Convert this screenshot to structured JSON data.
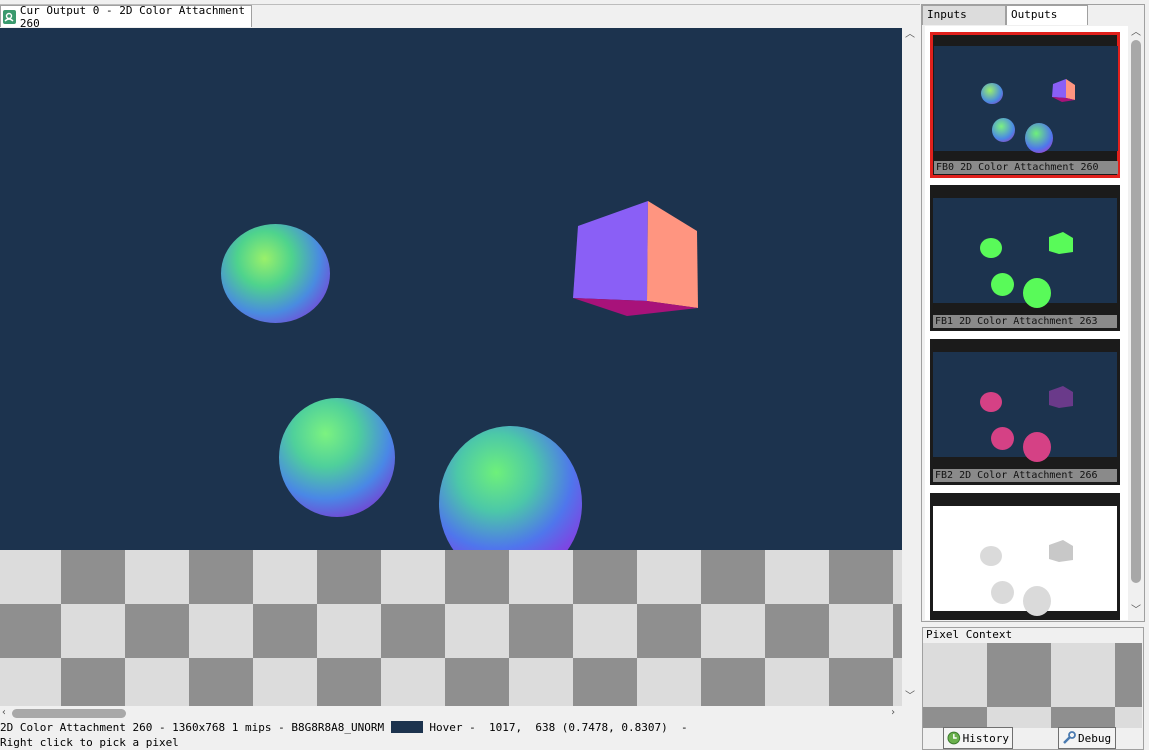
{
  "main_tab": {
    "title": "Cur Output 0 - 2D Color Attachment 260"
  },
  "right_panel": {
    "tabs": {
      "inputs": "Inputs",
      "outputs": "Outputs"
    },
    "thumbnails": [
      {
        "label": "FB0   2D Color Attachment 260",
        "selected": true
      },
      {
        "label": "FB1   2D Color Attachment 263",
        "selected": false
      },
      {
        "label": "FB2   2D Color Attachment 266",
        "selected": false
      },
      {
        "label": "",
        "selected": false
      }
    ]
  },
  "status": {
    "line1_left": "2D Color Attachment 260 - 1360x768 1 mips - B8G8R8A8_UNORM",
    "line1_right": "Hover -  1017,  638 (0.7478, 0.8307)  -",
    "line2": "Right click to pick a pixel",
    "swatch_color": "#1c334e"
  },
  "pixel_context": {
    "title": "Pixel Context",
    "history_label": "History",
    "debug_label": "Debug"
  },
  "colors": {
    "background": "#1c334e",
    "selected_border": "#e0201c",
    "checker_light": "#dcdcdc",
    "checker_dark": "#8f8f8f"
  },
  "icons": [
    "texture-viewer-icon",
    "history-icon",
    "debug-icon"
  ]
}
